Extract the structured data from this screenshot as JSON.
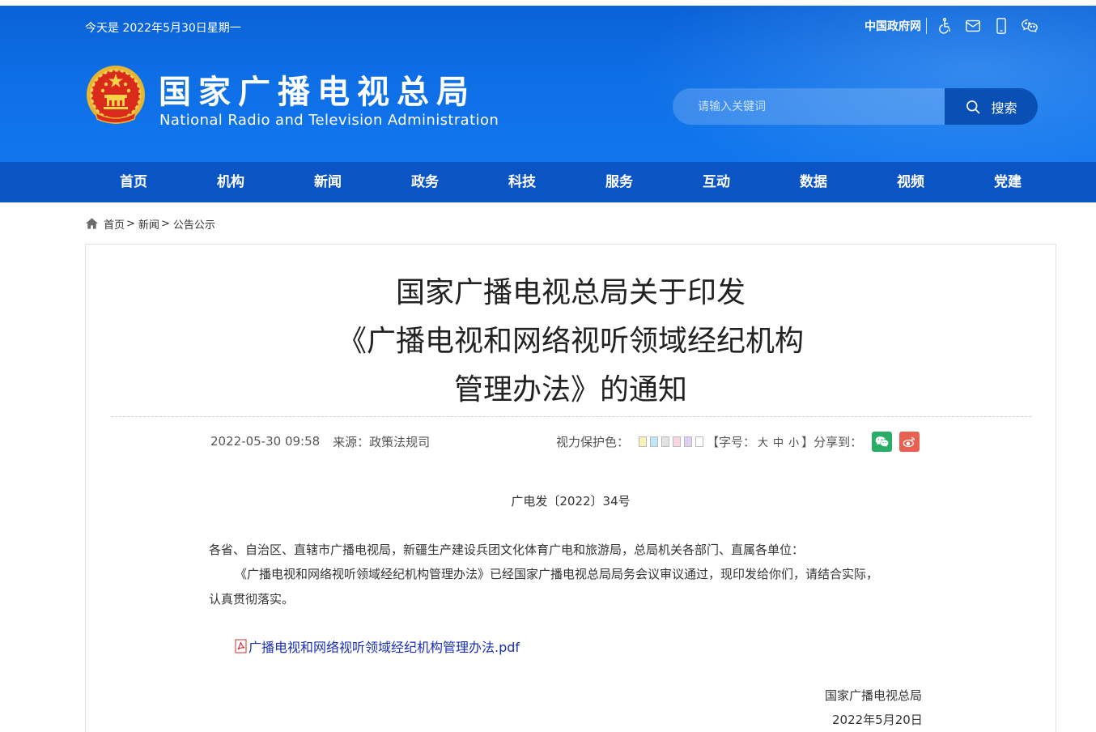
{
  "header": {
    "date_text": "今天是 2022年5月30日星期一",
    "gov_link": "中国政府网",
    "site_name_cn": "国家广播电视总局",
    "site_name_en": "National Radio and Television Administration",
    "search_placeholder": "请输入关键词",
    "search_button": "搜索",
    "top_icons": [
      "accessibility-icon",
      "mail-icon",
      "mobile-icon",
      "wechat-icon"
    ]
  },
  "nav": {
    "items": [
      "首页",
      "机构",
      "新闻",
      "政务",
      "科技",
      "服务",
      "互动",
      "数据",
      "视频",
      "党建"
    ]
  },
  "breadcrumb": {
    "items": [
      "首页",
      "新闻",
      "公告公示"
    ],
    "separator": ">"
  },
  "article": {
    "title_lines": [
      "国家广播电视总局关于印发",
      "《广播电视和网络视听领域经纪机构",
      "管理办法》的通知"
    ],
    "datetime": "2022-05-30 09:58",
    "source": "来源：政策法规司",
    "eye_care_label": "视力保护色：",
    "eye_care_colors": [
      "#f7f3b6",
      "#bfe6f5",
      "#e3e3e3",
      "#f8d7e3",
      "#ddd0f2",
      "#ffffff"
    ],
    "font_size_open": "【字号：",
    "font_sizes": [
      "大",
      "中",
      "小"
    ],
    "font_size_close": "】",
    "share_label": "分享到：",
    "share_icons": [
      "wechat-share-icon",
      "weibo-share-icon"
    ],
    "doc_number": "广电发〔2022〕34号",
    "recipients": "各省、自治区、直辖市广播电视局，新疆生产建设兵团文化体育广电和旅游局，总局机关各部门、直属各单位：",
    "paragraph_line1": "《广播电视和网络视听领域经纪机构管理办法》已经国家广播电视总局局务会议审议通过，现印发给你们，请结合实际，",
    "paragraph_line2": "认真贯彻落实。",
    "attachment": "广播电视和网络视听领域经纪机构管理办法.pdf",
    "signature_org": "国家广播电视总局",
    "signature_date": "2022年5月20日"
  },
  "colors": {
    "header_blue": "#0e6ee6",
    "nav_blue": "#0b54c4",
    "search_button": "#0a4fb4",
    "wechat_green": "#2aae67",
    "weibo_red": "#e8604f",
    "link_blue": "#1a2fb0"
  }
}
